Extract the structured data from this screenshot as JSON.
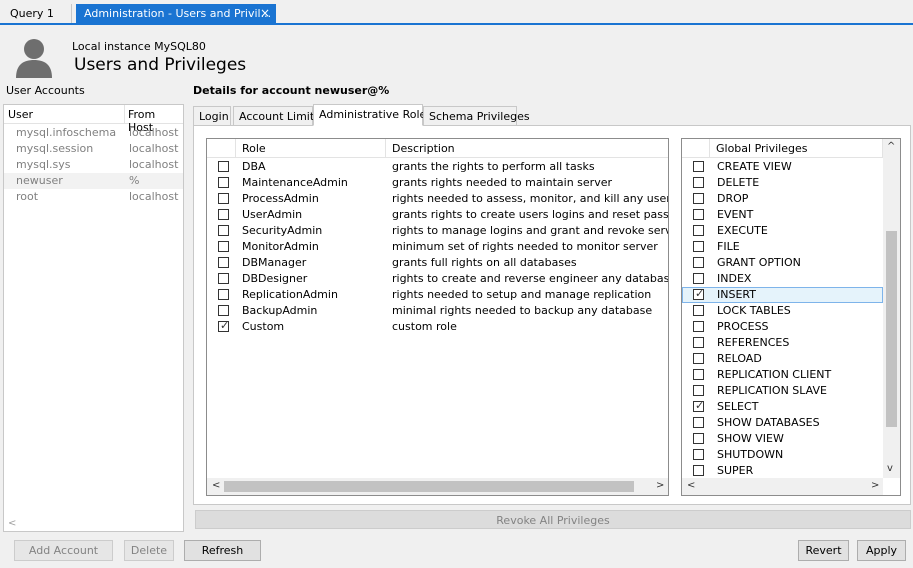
{
  "tabs": [
    {
      "label": "Query 1"
    },
    {
      "label": "Administration - Users and Privil...",
      "close": "×"
    }
  ],
  "header": {
    "instance": "Local instance MySQL80",
    "title": "Users and Privileges"
  },
  "user_accounts": {
    "title": "User Accounts",
    "columns": [
      "User",
      "From Host"
    ],
    "rows": [
      {
        "user": "mysql.infoschema",
        "host": "localhost"
      },
      {
        "user": "mysql.session",
        "host": "localhost"
      },
      {
        "user": "mysql.sys",
        "host": "localhost"
      },
      {
        "user": "newuser",
        "host": "%"
      },
      {
        "user": "root",
        "host": "localhost"
      }
    ],
    "scroll_left": "<"
  },
  "details": {
    "title": "Details for account newuser@%",
    "tabs": [
      "Login",
      "Account Limits",
      "Administrative Roles",
      "Schema Privileges"
    ],
    "active_tab": "Administrative Roles"
  },
  "roles": {
    "columns": [
      "Role",
      "Description"
    ],
    "rows": [
      {
        "role": "DBA",
        "desc": "grants the rights to perform all tasks",
        "checked": false
      },
      {
        "role": "MaintenanceAdmin",
        "desc": "grants rights needed to maintain server",
        "checked": false
      },
      {
        "role": "ProcessAdmin",
        "desc": "rights needed to assess, monitor, and kill any user proc",
        "checked": false
      },
      {
        "role": "UserAdmin",
        "desc": "grants rights to create users logins and reset password",
        "checked": false
      },
      {
        "role": "SecurityAdmin",
        "desc": "rights to manage logins and grant and revoke server ar",
        "checked": false
      },
      {
        "role": "MonitorAdmin",
        "desc": "minimum set of rights needed to monitor server",
        "checked": false
      },
      {
        "role": "DBManager",
        "desc": "grants full rights on all databases",
        "checked": false
      },
      {
        "role": "DBDesigner",
        "desc": "rights to create and reverse engineer any database sch",
        "checked": false
      },
      {
        "role": "ReplicationAdmin",
        "desc": "rights needed to setup and manage replication",
        "checked": false
      },
      {
        "role": "BackupAdmin",
        "desc": "minimal rights needed to backup any database",
        "checked": false
      },
      {
        "role": "Custom",
        "desc": "custom role",
        "checked": true
      }
    ]
  },
  "global_privileges": {
    "column": "Global Privileges",
    "rows": [
      {
        "name": "CREATE VIEW",
        "checked": false
      },
      {
        "name": "DELETE",
        "checked": false
      },
      {
        "name": "DROP",
        "checked": false
      },
      {
        "name": "EVENT",
        "checked": false
      },
      {
        "name": "EXECUTE",
        "checked": false
      },
      {
        "name": "FILE",
        "checked": false
      },
      {
        "name": "GRANT OPTION",
        "checked": false
      },
      {
        "name": "INDEX",
        "checked": false
      },
      {
        "name": "INSERT",
        "checked": true,
        "selected": true
      },
      {
        "name": "LOCK TABLES",
        "checked": false
      },
      {
        "name": "PROCESS",
        "checked": false
      },
      {
        "name": "REFERENCES",
        "checked": false
      },
      {
        "name": "RELOAD",
        "checked": false
      },
      {
        "name": "REPLICATION CLIENT",
        "checked": false
      },
      {
        "name": "REPLICATION SLAVE",
        "checked": false
      },
      {
        "name": "SELECT",
        "checked": true
      },
      {
        "name": "SHOW DATABASES",
        "checked": false
      },
      {
        "name": "SHOW VIEW",
        "checked": false
      },
      {
        "name": "SHUTDOWN",
        "checked": false
      },
      {
        "name": "SUPER",
        "checked": false
      }
    ]
  },
  "buttons": {
    "revoke_all": "Revoke All Privileges",
    "add_account": "Add Account",
    "delete": "Delete",
    "refresh": "Refresh",
    "revert": "Revert",
    "apply": "Apply"
  },
  "glyphs": {
    "check": "✓",
    "left": "<",
    "right": ">",
    "up": "^",
    "down": "v"
  }
}
